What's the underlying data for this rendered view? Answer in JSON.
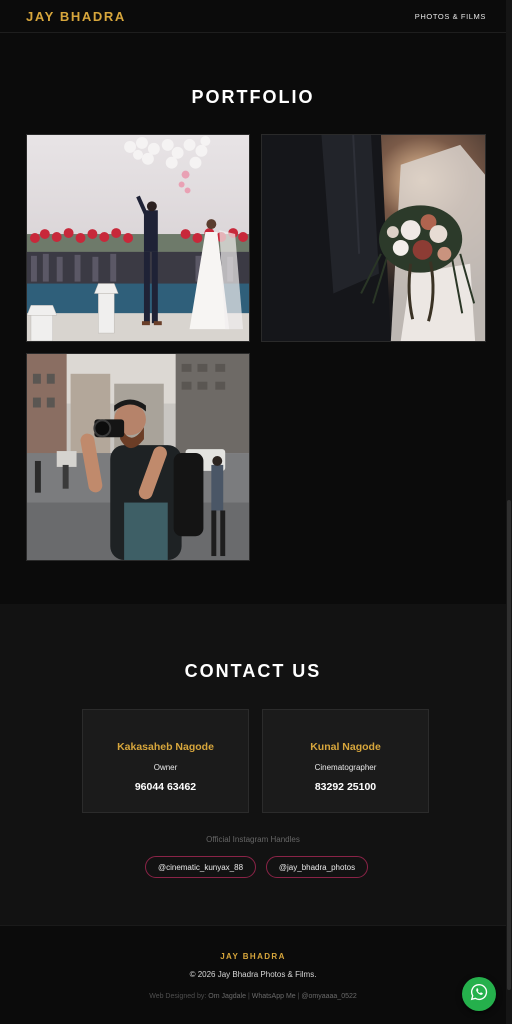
{
  "nav": {
    "brand": "JAY BHADRA",
    "link": "PHOTOS & FILMS"
  },
  "portfolio": {
    "title": "PORTFOLIO",
    "images": [
      {
        "name": "wedding-couple-balloons-photo"
      },
      {
        "name": "bride-bouquet-photo"
      },
      {
        "name": "street-photographer-photo"
      }
    ]
  },
  "contact": {
    "title": "CONTACT US",
    "cards": [
      {
        "name": "Kakasaheb Nagode",
        "role": "Owner",
        "phone": "96044 63462"
      },
      {
        "name": "Kunal Nagode",
        "role": "Cinematographer",
        "phone": "83292 25100"
      }
    ],
    "instagram_label": "Official Instagram Handles",
    "handles": [
      "@cinematic_kunyax_88",
      "@jay_bhadra_photos"
    ]
  },
  "footer": {
    "brand": "JAY BHADRA",
    "copyright": "© 2026 Jay Bhadra Photos & Films.",
    "credit_prefix": "Web Designed by:",
    "credit_name": "Om Jagdale",
    "credit_sep1": " | ",
    "credit_whatsapp": "WhatsApp Me",
    "credit_sep2": " | ",
    "credit_handle": "@omyaaaa_0522"
  },
  "fab": {
    "icon": "whatsapp-icon"
  },
  "colors": {
    "accent": "#d7a63c",
    "background": "#0b0b0b",
    "card": "#1b1b1b",
    "handle_border": "#8a2347",
    "whatsapp": "#25b04c"
  }
}
